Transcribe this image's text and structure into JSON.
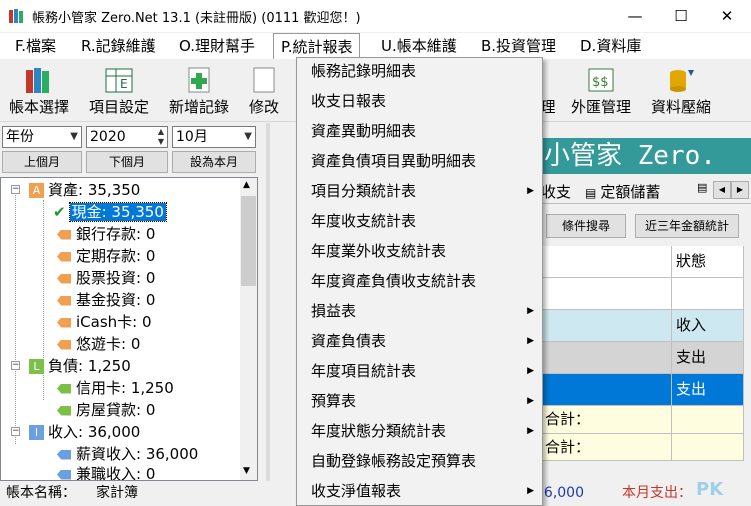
{
  "window": {
    "title": "帳務小管家 Zero.Net 13.1 (未註冊版) (0111 歡迎您！)",
    "minimize": "—",
    "maximize": "☐",
    "close": "✕"
  },
  "menubar": [
    "F.檔案",
    "R.記錄維護",
    "O.理財幫手",
    "P.統計報表",
    "U.帳本維護",
    "B.投資管理",
    "D.資料庫"
  ],
  "toolbar": [
    "帳本選擇",
    "項目設定",
    "新增記錄",
    "修改",
    "理",
    "外匯管理",
    "資料壓縮"
  ],
  "filters": {
    "period_type": "年份",
    "year": "2020",
    "month": "10月",
    "prev_month": "上個月",
    "next_month": "下個月",
    "this_month": "設為本月"
  },
  "tree": {
    "assets": {
      "badge": "A",
      "label": "資產: 35,350",
      "children": [
        "現金: 35,350",
        "銀行存款: 0",
        "定期存款: 0",
        "股票投資: 0",
        "基金投資: 0",
        "iCash卡: 0",
        "悠遊卡: 0"
      ]
    },
    "liabilities": {
      "badge": "L",
      "label": "負債: 1,250",
      "children": [
        "信用卡: 1,250",
        "房屋貸款: 0"
      ]
    },
    "income": {
      "badge": "I",
      "label": "收入: 36,000",
      "children": [
        "薪資收入: 36,000",
        "兼職收入: 0"
      ]
    }
  },
  "status": {
    "ledger_label": "帳本名稱：",
    "ledger_name": "家計簿",
    "income_total": "36,000",
    "month_expense": "本月支出："
  },
  "right": {
    "banner": "小管家 Zero.",
    "tabs": [
      "收支",
      "定額儲蓄"
    ],
    "search_btn": "條件搜尋",
    "stats_btn": "近三年金額統計",
    "grid_header": "狀態",
    "rows": [
      "",
      "收入",
      "支出",
      "支出"
    ],
    "totals": [
      "合計：",
      "合計："
    ]
  },
  "dropdown": [
    {
      "label": "帳務記錄明細表",
      "sub": false
    },
    {
      "label": "收支日報表",
      "sub": false
    },
    {
      "label": "資產異動明細表",
      "sub": false
    },
    {
      "label": "資產負債項目異動明細表",
      "sub": false
    },
    {
      "label": "項目分類統計表",
      "sub": true
    },
    {
      "label": "年度收支統計表",
      "sub": false
    },
    {
      "label": "年度業外收支統計表",
      "sub": false
    },
    {
      "label": "年度資產負債收支統計表",
      "sub": false
    },
    {
      "label": "損益表",
      "sub": true
    },
    {
      "label": "資產負債表",
      "sub": true
    },
    {
      "label": "年度項目統計表",
      "sub": true
    },
    {
      "label": "預算表",
      "sub": true
    },
    {
      "label": "年度狀態分類統計表",
      "sub": true
    },
    {
      "label": "自動登錄帳務設定預算表",
      "sub": false
    },
    {
      "label": "收支淨值報表",
      "sub": true
    }
  ],
  "watermark": "PK",
  "colors": {
    "selection": "#0078d7",
    "banner": "#339999",
    "asset_badge": "#f0a050",
    "liab_badge": "#7cc04a",
    "income_badge": "#6aa0e0",
    "row_blue": "#cde8f0",
    "row_gray": "#d4d4d4",
    "row_yellow": "#fffde0"
  }
}
